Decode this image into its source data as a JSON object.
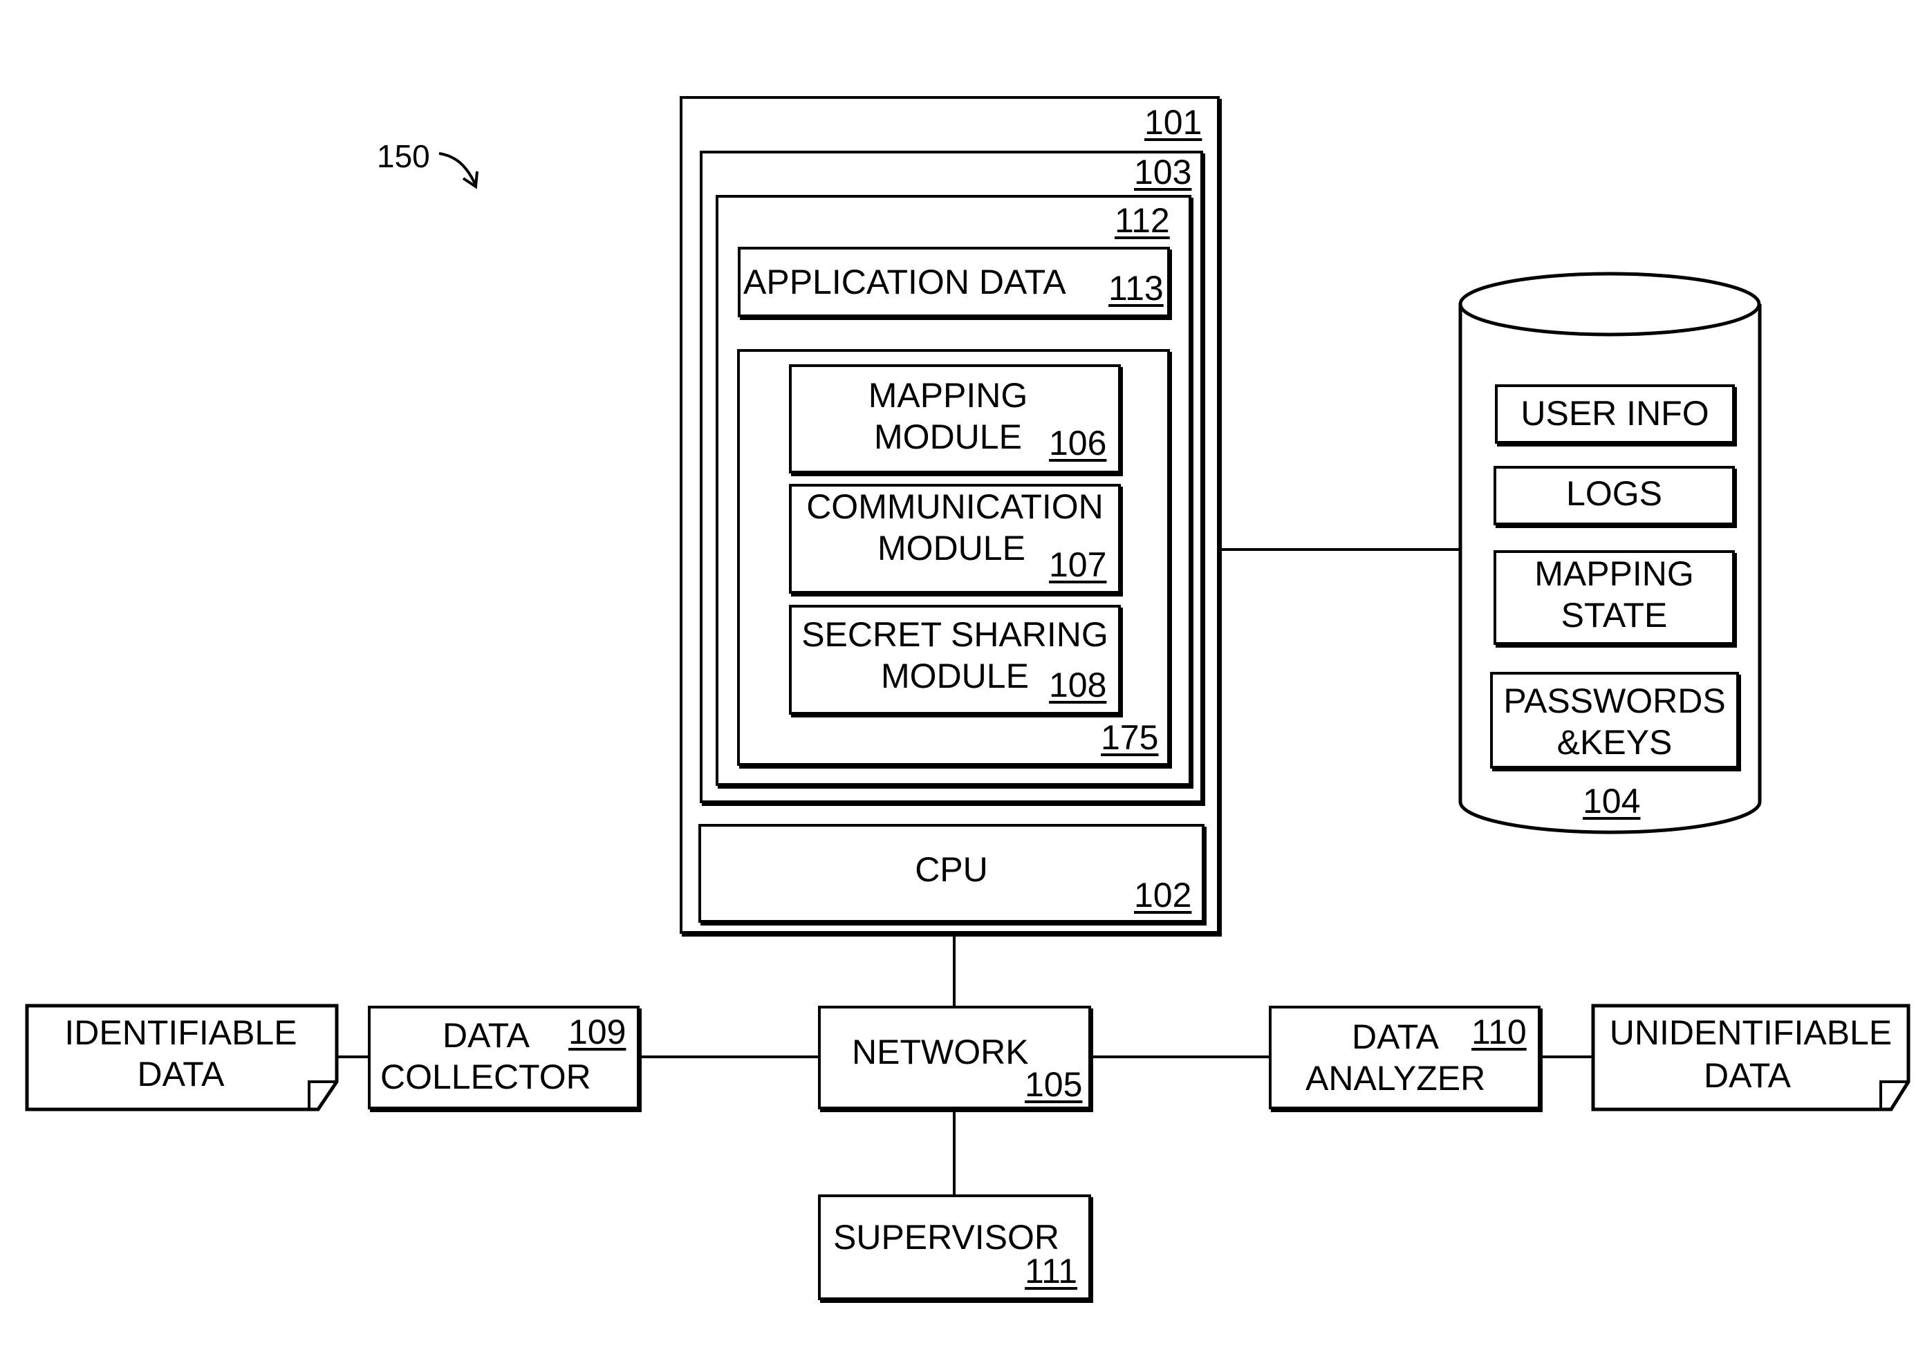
{
  "figure": {
    "label": "150"
  },
  "server": {
    "ref": "101",
    "memory": {
      "ref": "103"
    },
    "application": {
      "ref": "112",
      "app_data": {
        "label": "APPLICATION DATA",
        "ref": "113"
      },
      "modules_container": {
        "ref": "175",
        "modules": [
          {
            "line1": "MAPPING",
            "line2": "MODULE",
            "ref": "106"
          },
          {
            "line1": "COMMUNICATION",
            "line2": "MODULE",
            "ref": "107"
          },
          {
            "line1": "SECRET SHARING",
            "line2": "MODULE",
            "ref": "108"
          }
        ]
      }
    },
    "cpu": {
      "label": "CPU",
      "ref": "102"
    }
  },
  "database": {
    "ref": "104",
    "items": [
      {
        "line1": "USER INFO",
        "line2": ""
      },
      {
        "line1": "LOGS",
        "line2": ""
      },
      {
        "line1": "MAPPING",
        "line2": "STATE"
      },
      {
        "line1": "PASSWORDS",
        "line2": "&KEYS"
      }
    ]
  },
  "network": {
    "label": "NETWORK",
    "ref": "105"
  },
  "supervisor": {
    "label": "SUPERVISOR",
    "ref": "111"
  },
  "identifiable_data": {
    "line1": "IDENTIFIABLE",
    "line2": "DATA"
  },
  "data_collector": {
    "line1": "DATA",
    "line2": "COLLECTOR",
    "ref": "109"
  },
  "data_analyzer": {
    "line1": "DATA",
    "line2": "ANALYZER",
    "ref": "110"
  },
  "unidentifiable_data": {
    "line1": "UNIDENTIFIABLE",
    "line2": "DATA"
  }
}
